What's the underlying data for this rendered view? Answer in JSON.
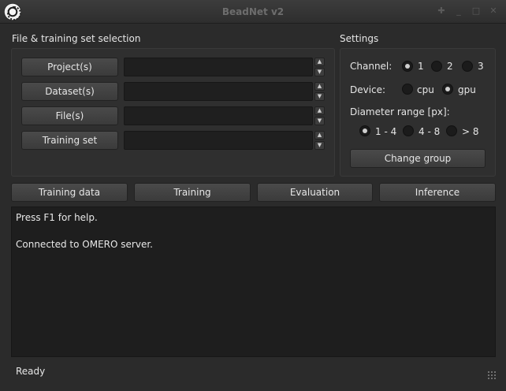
{
  "window": {
    "title": "BeadNet v2",
    "icon": "beadnet-logo-icon"
  },
  "file_section": {
    "label": "File & training set selection",
    "rows": [
      {
        "button": "Project(s)"
      },
      {
        "button": "Dataset(s)"
      },
      {
        "button": "File(s)"
      },
      {
        "button": "Training set"
      }
    ]
  },
  "settings": {
    "label": "Settings",
    "channel": {
      "label": "Channel:",
      "options": [
        "1",
        "2",
        "3"
      ],
      "selected": "1"
    },
    "device": {
      "label": "Device:",
      "options": [
        "cpu",
        "gpu"
      ],
      "selected": "gpu"
    },
    "diameter": {
      "label": "Diameter range [px]:",
      "options": [
        "1 - 4",
        "4 - 8",
        "> 8"
      ],
      "selected": "1 - 4"
    },
    "change_group": "Change group"
  },
  "tabs": [
    "Training data",
    "Training",
    "Evaluation",
    "Inference"
  ],
  "console": {
    "lines": [
      "Press F1 for help.",
      "Connected to OMERO server."
    ]
  },
  "status": "Ready"
}
